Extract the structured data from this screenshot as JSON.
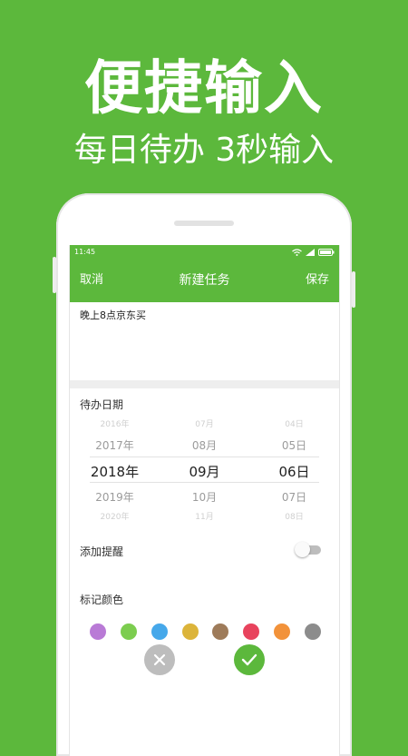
{
  "promo": {
    "headline": "便捷输入",
    "subline": "每日待办 3秒输入"
  },
  "status_bar": {
    "time": "11:45",
    "icons": [
      "wifi-icon",
      "signal-icon",
      "battery-icon"
    ]
  },
  "toolbar": {
    "cancel_label": "取消",
    "title": "新建任务",
    "save_label": "保存"
  },
  "task": {
    "input_value": "晚上8点京东买"
  },
  "date_section": {
    "label": "待办日期",
    "picker": {
      "rows": [
        {
          "year": "2016年",
          "month": "07月",
          "day": "04日"
        },
        {
          "year": "2017年",
          "month": "08月",
          "day": "05日"
        },
        {
          "year": "2018年",
          "month": "09月",
          "day": "06日"
        },
        {
          "year": "2019年",
          "month": "10月",
          "day": "07日"
        },
        {
          "year": "2020年",
          "month": "11月",
          "day": "08日"
        }
      ],
      "selected_index": 2
    }
  },
  "reminder": {
    "label": "添加提醒",
    "enabled": false
  },
  "color_section": {
    "label": "标记颜色",
    "colors": [
      "#b97ad6",
      "#7ccd4f",
      "#46a8ea",
      "#dcb43a",
      "#9e7b5a",
      "#e8435d",
      "#f2923a",
      "#8c8c8c"
    ]
  },
  "actions": {
    "cancel_color": "#bdbdbd",
    "confirm_color": "#5cb83c"
  },
  "theme": {
    "accent": "#5cb83c"
  }
}
